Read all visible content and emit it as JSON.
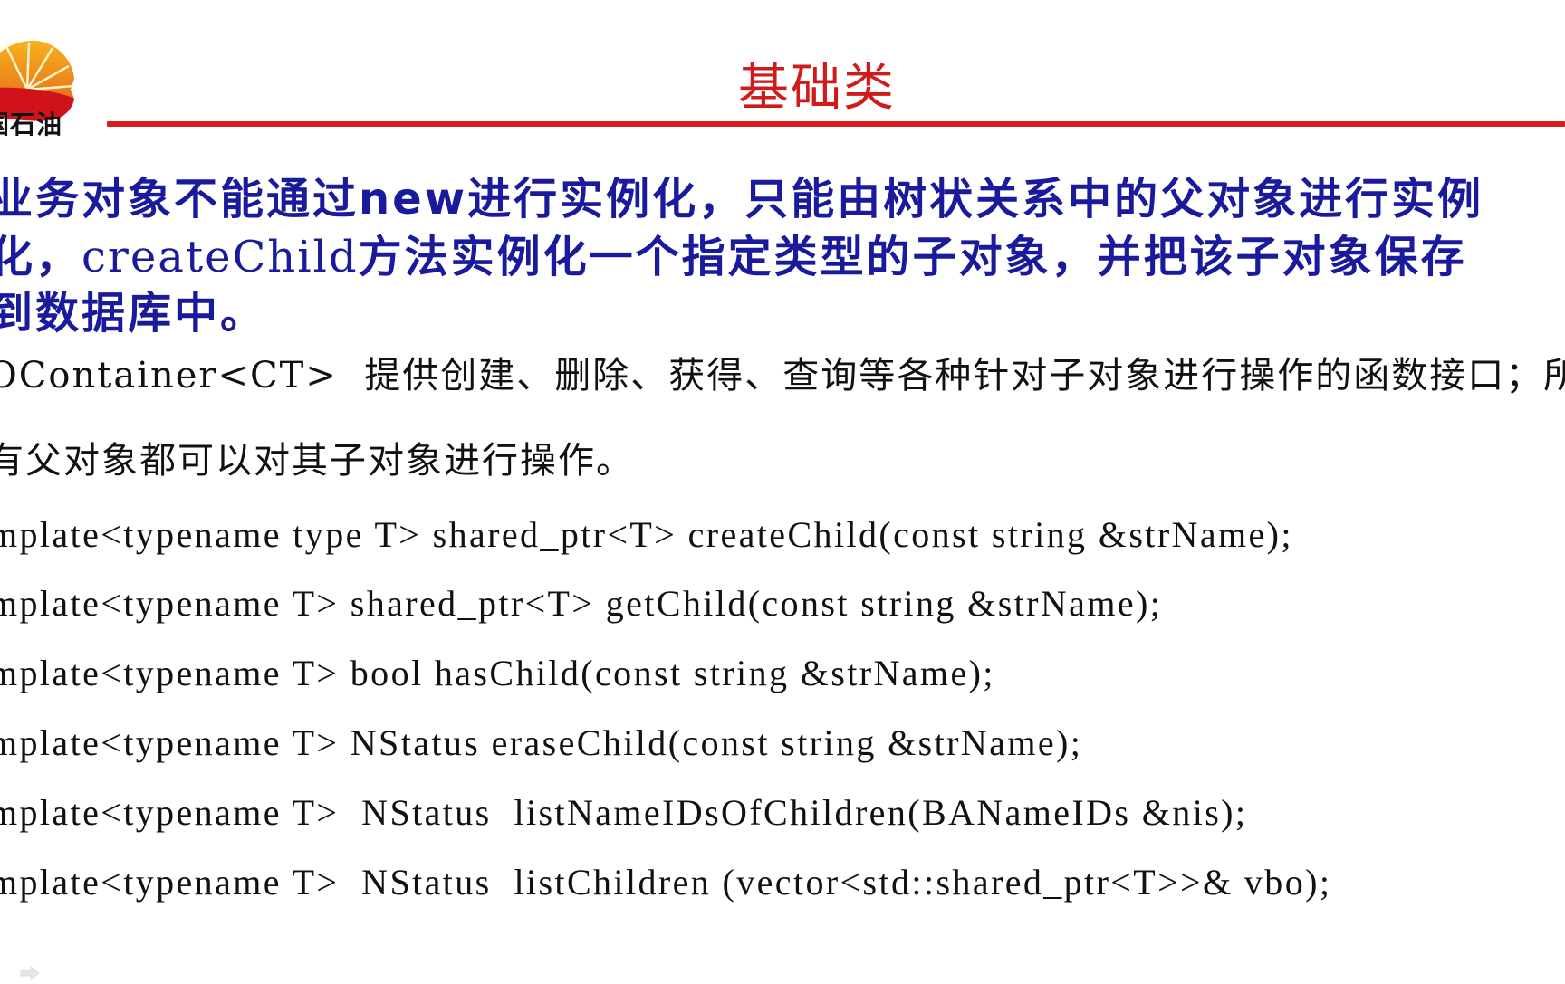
{
  "slide": {
    "logo": {
      "icon": "petrochina-logo-icon",
      "text": "国石油",
      "colors": {
        "rays": "#f5a623",
        "base": "#d0121b"
      }
    },
    "title": "基础类",
    "accent_color": "#d81e1e",
    "paragraph1": {
      "line1": "业务对象不能通过new进行实例化，只能由树状关系中的父对象进行实例",
      "line2_prefix": "化，",
      "line2_code": "createChild",
      "line2_suffix": "方法实例化一个指定类型的子对象，并把该子对象保存",
      "line3": "到数据库中。",
      "color": "#1a1a9c"
    },
    "paragraph2": {
      "line1": "OContainer<CT>  提供创建、删除、获得、查询等各种针对子对象进行操作的函数接口；所",
      "line2": "有父对象都可以对其子对象进行操作。"
    },
    "code_lines": [
      "mplate<typename type T> shared_ptr<T> createChild(const string &strName);",
      "mplate<typename T> shared_ptr<T> getChild(const string &strName);",
      "mplate<typename T> bool hasChild(const string &strName);",
      "mplate<typename T> NStatus eraseChild(const string &strName);",
      "mplate<typename T>  NStatus  listNameIDsOfChildren(BANameIDs &nis);",
      "mplate<typename T>  NStatus  listChildren (vector<std::shared_ptr<T>>& vbo);"
    ],
    "nav": {
      "icon": "next-slide-arrow-icon"
    }
  }
}
